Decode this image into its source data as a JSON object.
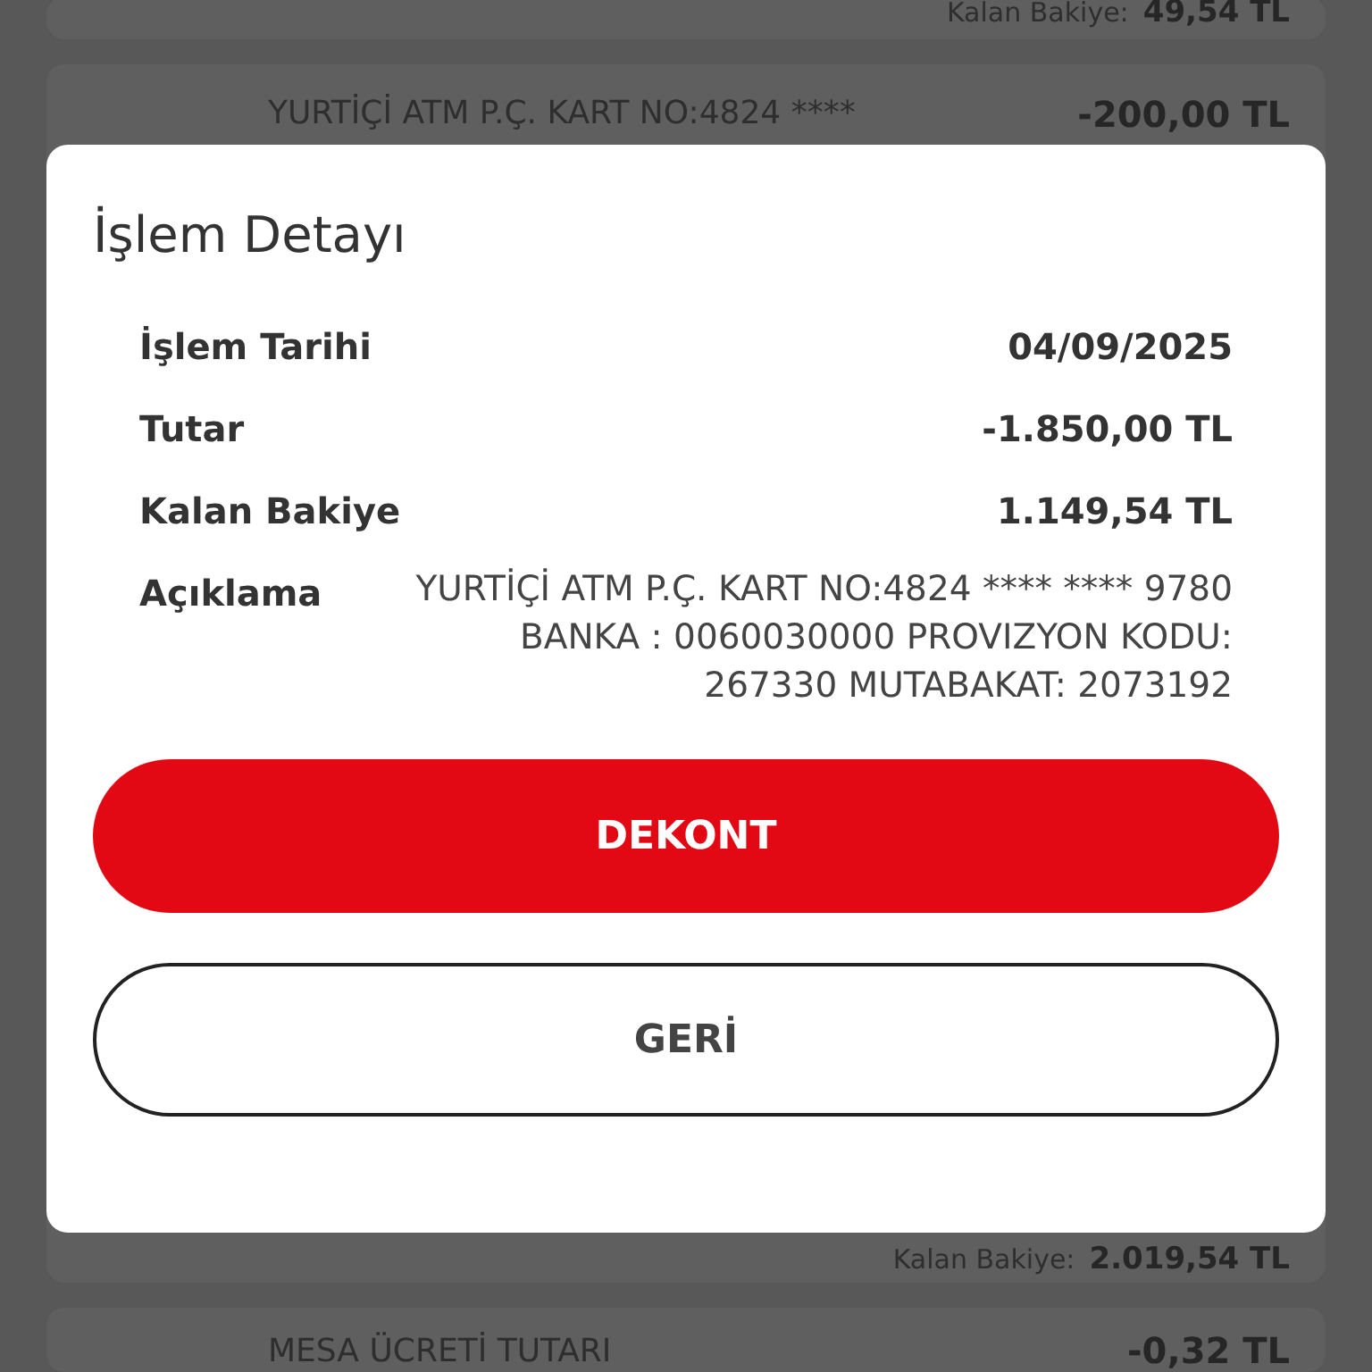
{
  "background_list": {
    "top_card": {
      "balance_label": "Kalan Bakiye:",
      "balance": "49,54 TL"
    },
    "middle_card": {
      "description": "YURTİÇİ ATM P.Ç. KART NO:4824 ****",
      "amount": "-200,00 TL",
      "balance_label": "Kalan Bakiye:",
      "balance": "2.019,54 TL"
    },
    "bottom_card": {
      "description": "MESA ÜCRETİ TUTARI",
      "amount": "-0,32 TL"
    }
  },
  "dialog": {
    "title": "İşlem Detayı",
    "rows": [
      {
        "label": "İşlem Tarihi",
        "value": "04/09/2025"
      },
      {
        "label": "Tutar",
        "value": "-1.850,00 TL"
      },
      {
        "label": "Kalan Bakiye",
        "value": "1.149,54 TL"
      },
      {
        "label": "Açıklama",
        "value": "YURTİÇİ ATM P.Ç. KART NO:4824 **** **** 9780 BANKA : 0060030000 PROVIZYON KODU: 267330 MUTABAKAT: 2073192",
        "kind": "long"
      }
    ],
    "buttons": [
      {
        "label": "DEKONT",
        "kind": "primary"
      },
      {
        "label": "GERİ",
        "kind": "secondary"
      }
    ]
  }
}
